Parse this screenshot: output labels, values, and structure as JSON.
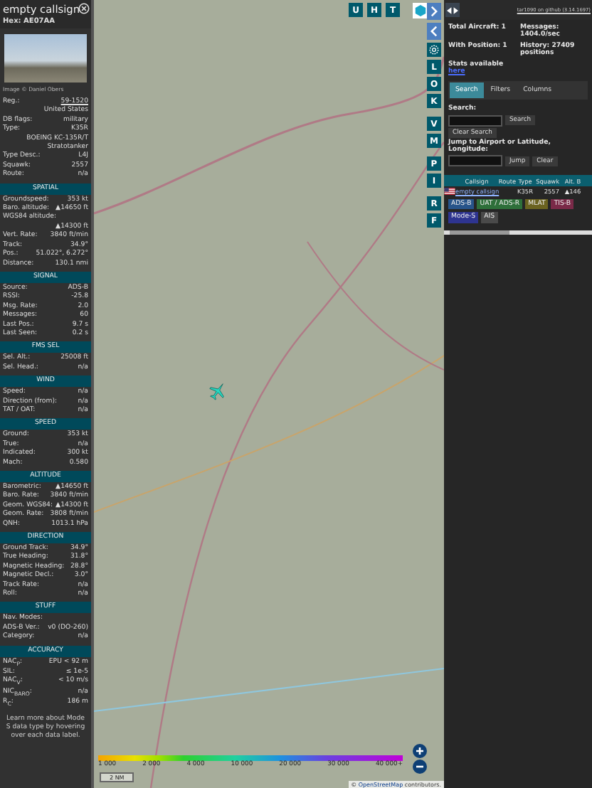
{
  "sidebar": {
    "title": "empty callsign",
    "hex": "Hex: AE07AA",
    "photo_caption": "Image © Daniel Obers",
    "details": [
      {
        "label": "Reg.:",
        "value": "59-1520",
        "link": true
      },
      {
        "value": "United States",
        "link": false
      },
      {
        "label": "DB flags:",
        "value": "military",
        "link": false
      },
      {
        "label": "Type:",
        "value": "K35R",
        "link": false
      },
      {
        "value": "BOEING KC-135R/T Stratotanker",
        "link": false
      },
      {
        "label": "Type Desc.:",
        "value": "L4J",
        "link": false
      },
      {
        "label": "Squawk:",
        "value": "2557",
        "link": false
      },
      {
        "label": "Route:",
        "value": "n/a",
        "link": false
      }
    ],
    "sections": [
      {
        "title": "SPATIAL",
        "rows": [
          {
            "kind": "pair",
            "label": "Groundspeed:",
            "value": "353 kt"
          },
          {
            "kind": "pair",
            "label": "Baro. altitude:",
            "value": "▲14650 ft"
          },
          {
            "kind": "stacked",
            "label": "WGS84 altitude:",
            "value": "▲14300 ft"
          },
          {
            "kind": "pair",
            "label": "Vert. Rate:",
            "value": "3840 ft/min"
          },
          {
            "kind": "pair",
            "label": "Track:",
            "value": "34.9°"
          },
          {
            "kind": "pair",
            "label": "Pos.:",
            "value": "51.022°, 6.272°"
          },
          {
            "kind": "pair",
            "label": "Distance:",
            "value": "130.1 nmi"
          }
        ]
      },
      {
        "title": "SIGNAL",
        "rows": [
          {
            "kind": "pair",
            "label": "Source:",
            "value": "ADS-B"
          },
          {
            "kind": "pair",
            "label": "RSSI:",
            "value": "-25.8"
          },
          {
            "kind": "pair",
            "label": "Msg. Rate:",
            "value": "2.0"
          },
          {
            "kind": "pair",
            "label": "Messages:",
            "value": "60"
          },
          {
            "kind": "pair",
            "label": "Last Pos.:",
            "value": "9.7 s"
          },
          {
            "kind": "pair",
            "label": "Last Seen:",
            "value": "0.2 s"
          }
        ]
      },
      {
        "title": "FMS SEL",
        "rows": [
          {
            "kind": "pair",
            "label": "Sel. Alt.:",
            "value": "25008 ft"
          },
          {
            "kind": "pair",
            "label": "Sel. Head.:",
            "value": "n/a"
          }
        ]
      },
      {
        "title": "WIND",
        "rows": [
          {
            "kind": "pair",
            "label": "Speed:",
            "value": "n/a"
          },
          {
            "kind": "pair",
            "label": "Direction (from):",
            "value": "n/a"
          },
          {
            "kind": "pair",
            "label": "TAT / OAT:",
            "value": "n/a"
          }
        ]
      },
      {
        "title": "SPEED",
        "rows": [
          {
            "kind": "pair",
            "label": "Ground:",
            "value": "353 kt"
          },
          {
            "kind": "pair",
            "label": "True:",
            "value": "n/a"
          },
          {
            "kind": "pair",
            "label": "Indicated:",
            "value": "300 kt"
          },
          {
            "kind": "pair",
            "label": "Mach:",
            "value": "0.580"
          }
        ]
      },
      {
        "title": "ALTITUDE",
        "rows": [
          {
            "kind": "pair",
            "label": "Barometric:",
            "value": "▲14650 ft"
          },
          {
            "kind": "pair",
            "label": "Baro. Rate:",
            "value": "3840 ft/min"
          },
          {
            "kind": "pair",
            "label": "Geom. WGS84:",
            "value": "▲14300 ft"
          },
          {
            "kind": "pair",
            "label": "Geom. Rate:",
            "value": "3808 ft/min"
          },
          {
            "kind": "pair",
            "label": "QNH:",
            "value": "1013.1 hPa"
          }
        ]
      },
      {
        "title": "DIRECTION",
        "rows": [
          {
            "kind": "pair",
            "label": "Ground Track:",
            "value": "34.9°"
          },
          {
            "kind": "pair",
            "label": "True Heading:",
            "value": "31.8°"
          },
          {
            "kind": "pair",
            "label": "Magnetic Heading:",
            "value": "28.8°"
          },
          {
            "kind": "pair",
            "label": "Magnetic Decl.:",
            "value": "3.0°"
          },
          {
            "kind": "pair",
            "label": "Track Rate:",
            "value": "n/a"
          },
          {
            "kind": "pair",
            "label": "Roll:",
            "value": "n/a"
          }
        ]
      },
      {
        "title": "STUFF",
        "rows": [
          {
            "kind": "pair",
            "label": "Nav. Modes:"
          },
          {
            "kind": "pair",
            "label": "ADS-B Ver.:",
            "value": "v0 (DO-260)"
          },
          {
            "kind": "pair",
            "label": "Category:",
            "value": "n/a"
          }
        ]
      },
      {
        "title": "ACCURACY",
        "rows": [
          {
            "kind": "pair",
            "label": "NAC$_{P}$:",
            "value": "EPU < 92 m"
          },
          {
            "kind": "pair",
            "label": "SIL:",
            "value": "≤ 1e-5"
          },
          {
            "kind": "pair",
            "label": "NAC$_{V}$:",
            "value": "< 10 m/s"
          },
          {
            "kind": "pair",
            "label": "NIC$_{BARO}$:",
            "value": "n/a"
          },
          {
            "kind": "pair",
            "label": "R$_{C}$:",
            "value": "186 m"
          }
        ]
      }
    ],
    "footer": "Learn more about Mode S data type by hovering over each data label."
  },
  "map": {
    "top_buttons": [
      "U",
      "H",
      "T"
    ],
    "side_buttons": [
      {
        "kind": "expand"
      },
      {
        "kind": "collapse"
      },
      {
        "kind": "gear"
      },
      {
        "kind": "letter",
        "label": "L"
      },
      {
        "kind": "letter",
        "label": "O"
      },
      {
        "kind": "letter",
        "label": "K"
      },
      {
        "kind": "gap"
      },
      {
        "kind": "letter",
        "label": "V"
      },
      {
        "kind": "letter",
        "label": "M"
      },
      {
        "kind": "gap"
      },
      {
        "kind": "letter",
        "label": "P"
      },
      {
        "kind": "letter",
        "label": "I"
      },
      {
        "kind": "gap"
      },
      {
        "kind": "letter",
        "label": "R"
      },
      {
        "kind": "letter",
        "label": "F"
      }
    ],
    "legend_ticks": [
      "1 000",
      "2 000",
      "4 000",
      "10 000",
      "20 000",
      "30 000",
      "40 000+"
    ],
    "scale": "2 NM",
    "attribution_prefix": "©",
    "attribution_link": "OpenStreetMap",
    "attribution_suffix": "contributors."
  },
  "panel": {
    "version": "tar1090 on github (3.14.1697)",
    "stats": [
      {
        "label": "Total Aircraft: 1"
      },
      {
        "label": "Messages: 1404.0/sec"
      },
      {
        "label": "With Position: 1"
      },
      {
        "label": "History: 27409 positions"
      }
    ],
    "stats_note": "Stats available",
    "stats_link": "here",
    "tabs": [
      {
        "label": "Search",
        "selected": true
      },
      {
        "label": "Filters",
        "selected": false
      },
      {
        "label": "Columns",
        "selected": false
      }
    ],
    "search_label": "Search:",
    "search_button": "Search",
    "clear_button": "Clear Search",
    "jump_label": "Jump to Airport or Latitude, Longitude:",
    "jump_button": "Jump",
    "jump_clear": "Clear",
    "table": {
      "columns": [
        "Callsign",
        "Route",
        "Type",
        "Squawk",
        "Alt. B"
      ],
      "rows": [
        {
          "callsign": "empty callsign",
          "type": "K35R",
          "squawk": "2557",
          "alt": "▲146"
        }
      ]
    },
    "sources": [
      {
        "label": "ADS-B",
        "color": "#27548a"
      },
      {
        "label": "UAT / ADS-R",
        "color": "#2e6f3a"
      },
      {
        "label": "MLAT",
        "color": "#6b6320"
      },
      {
        "label": "TIS-B",
        "color": "#7a2a48"
      },
      {
        "label": "Mode-S",
        "color": "#2e3490"
      },
      {
        "label": "AIS",
        "color": "#4a4a4a"
      }
    ]
  }
}
